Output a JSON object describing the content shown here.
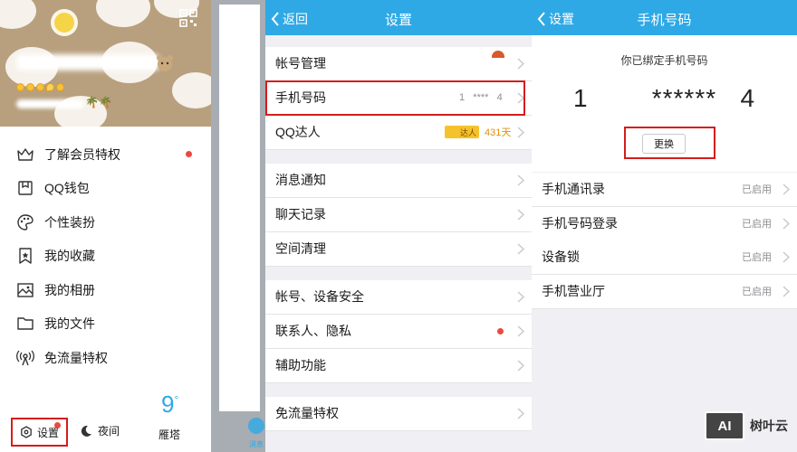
{
  "drawer": {
    "menu": [
      {
        "name": "vip",
        "label": "了解会员特权",
        "icon": "crown-icon",
        "dot": true
      },
      {
        "name": "wallet",
        "label": "QQ钱包",
        "icon": "wallet-icon",
        "dot": false
      },
      {
        "name": "theme",
        "label": "个性装扮",
        "icon": "palette-icon",
        "dot": false
      },
      {
        "name": "favorites",
        "label": "我的收藏",
        "icon": "bookmark-icon",
        "dot": false
      },
      {
        "name": "album",
        "label": "我的相册",
        "icon": "photo-icon",
        "dot": false
      },
      {
        "name": "files",
        "label": "我的文件",
        "icon": "folder-icon",
        "dot": false
      },
      {
        "name": "free-data",
        "label": "免流量特权",
        "icon": "signal-icon",
        "dot": false
      }
    ],
    "settings_label": "设置",
    "night_label": "夜间",
    "weather": {
      "temp": "9",
      "unit": "°",
      "city": "雁塔"
    },
    "peek_tab": "消息"
  },
  "settings_screen": {
    "back_label": "返回",
    "title": "设置",
    "rows": [
      {
        "name": "account",
        "label": "帐号管理",
        "value": ""
      },
      {
        "name": "phone",
        "label": "手机号码",
        "value": "1   ****   4"
      },
      {
        "name": "qq-master",
        "label": "QQ达人",
        "value": "431天",
        "badge": "达人"
      },
      {
        "name": "notify",
        "label": "消息通知",
        "value": ""
      },
      {
        "name": "chat-history",
        "label": "聊天记录",
        "value": ""
      },
      {
        "name": "storage",
        "label": "空间清理",
        "value": ""
      },
      {
        "name": "security",
        "label": "帐号、设备安全",
        "value": ""
      },
      {
        "name": "privacy",
        "label": "联系人、隐私",
        "value": "",
        "dot": true
      },
      {
        "name": "accessibility",
        "label": "辅助功能",
        "value": ""
      },
      {
        "name": "free-data",
        "label": "免流量特权",
        "value": ""
      }
    ]
  },
  "phone_screen": {
    "back_label": "设置",
    "title": "手机号码",
    "bound_text": "你已绑定手机号码",
    "number": "1        ******   4",
    "change_label": "更换",
    "rows": [
      {
        "name": "contacts",
        "label": "手机通讯录",
        "status": "已启用"
      },
      {
        "name": "phone-login",
        "label": "手机号码登录",
        "status": "已启用"
      },
      {
        "name": "device-lock",
        "label": "设备锁",
        "status": "已启用"
      },
      {
        "name": "mobile-hall",
        "label": "手机营业厅",
        "status": "已启用"
      }
    ]
  },
  "watermark": {
    "logo": "AI",
    "text": "树叶云"
  },
  "colors": {
    "accent": "#2ea9e6",
    "highlight": "#d41d1d",
    "dot": "#e94a3f",
    "bg": "#efeff4"
  }
}
